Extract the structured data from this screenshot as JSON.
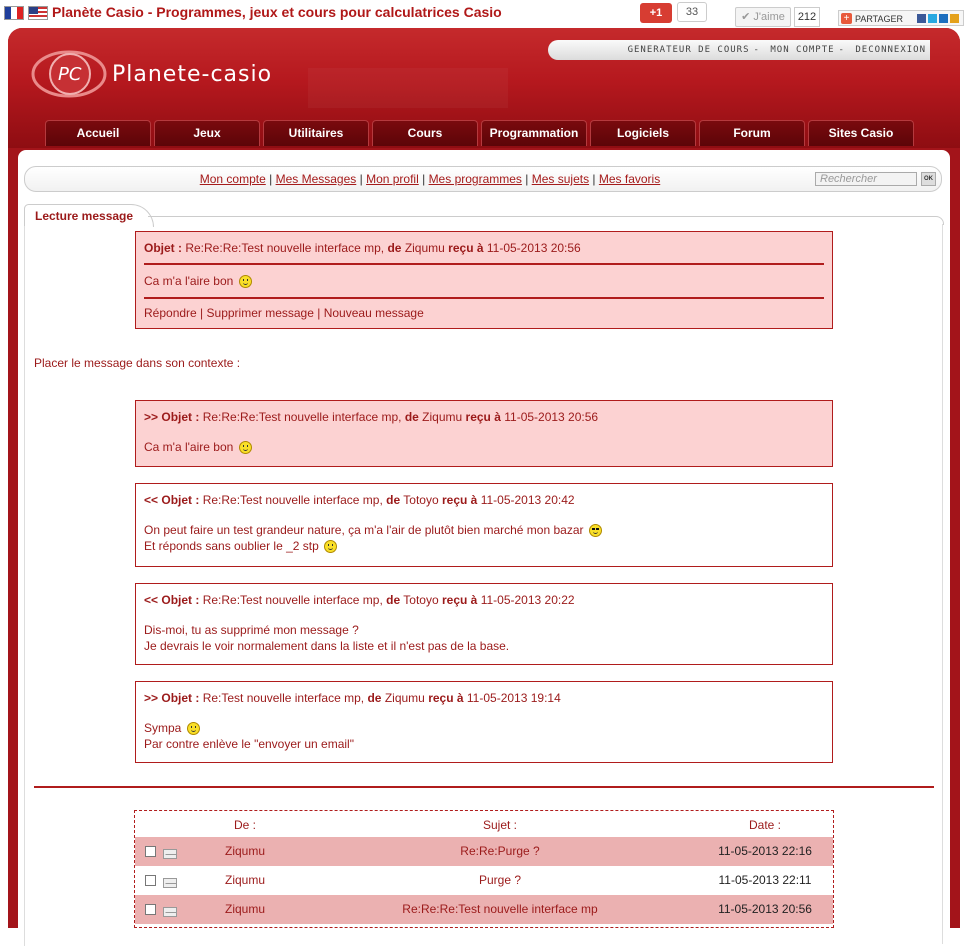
{
  "browser": {
    "title": "Planète Casio - Programmes, jeux et cours pour calculatrices Casio"
  },
  "social": {
    "gplus_label": "+1",
    "gplus_count": "33",
    "like_label": "J'aime",
    "like_count": "212",
    "share_label": "PARTAGER"
  },
  "header": {
    "logo_text": "Planete-casio",
    "top_links": [
      "GENERATEUR DE COURS",
      "MON COMPTE",
      "DECONNEXION"
    ]
  },
  "nav": [
    "Accueil",
    "Jeux",
    "Utilitaires",
    "Cours",
    "Programmation",
    "Logiciels",
    "Forum",
    "Sites Casio"
  ],
  "subnav": {
    "links": [
      "Mon compte",
      "Mes Messages",
      "Mon profil",
      "Mes programmes",
      "Mes sujets",
      "Mes favoris"
    ],
    "search_placeholder": "Rechercher",
    "search_button": "OK"
  },
  "section_title": "Lecture message",
  "current_message": {
    "subject_label": "Objet :",
    "subject": "Re:Re:Re:Test nouvelle interface mp,",
    "from_label": "de",
    "from": "Ziqumu",
    "received_label": "reçu à",
    "date": "11-05-2013 20:56",
    "body": "Ca m'a l'aire bon",
    "actions": [
      "Répondre",
      "Supprimer message",
      "Nouveau message"
    ]
  },
  "context_label": "Placer le message dans son contexte :",
  "thread": [
    {
      "dir": ">>",
      "subject": "Re:Re:Re:Test nouvelle interface mp,",
      "from": "Ziqumu",
      "date": "11-05-2013 20:56",
      "lines": [
        "Ca m'a l'aire bon"
      ],
      "smileys": [
        "smile"
      ],
      "highlight": true
    },
    {
      "dir": "<<",
      "subject": "Re:Re:Test nouvelle interface mp,",
      "from": "Totoyo",
      "date": "11-05-2013 20:42",
      "lines": [
        "On peut faire un test grandeur nature, ça m'a l'air de plutôt bien marché mon bazar",
        "Et réponds sans oublier le _2 stp"
      ],
      "smileys": [
        "cool",
        "smile"
      ],
      "highlight": false
    },
    {
      "dir": "<<",
      "subject": "Re:Re:Test nouvelle interface mp,",
      "from": "Totoyo",
      "date": "11-05-2013 20:22",
      "lines": [
        "Dis-moi, tu as supprimé mon message ?",
        "Je devrais le voir normalement dans la liste et il n'est pas de la base."
      ],
      "smileys": [],
      "highlight": false
    },
    {
      "dir": ">>",
      "subject": "Re:Test nouvelle interface mp,",
      "from": "Ziqumu",
      "date": "11-05-2013 19:14",
      "lines": [
        "Sympa",
        "Par contre enlève le \"envoyer un email\""
      ],
      "smileys": [
        "smile"
      ],
      "highlight": false
    }
  ],
  "table": {
    "headers": {
      "from": "De :",
      "subject": "Sujet :",
      "date": "Date :"
    },
    "rows": [
      {
        "from": "Ziqumu",
        "subject": "Re:Re:Purge ?",
        "date": "11-05-2013 22:16"
      },
      {
        "from": "Ziqumu",
        "subject": "Purge ?",
        "date": "11-05-2013 22:11"
      },
      {
        "from": "Ziqumu",
        "subject": "Re:Re:Re:Test nouvelle interface mp",
        "date": "11-05-2013 20:56"
      }
    ]
  },
  "colors": {
    "brand_red": "#a3141a",
    "text_red": "#9b1a1a",
    "pink_bg": "#fcd2d2",
    "row_alt": "#ebb1b1"
  }
}
